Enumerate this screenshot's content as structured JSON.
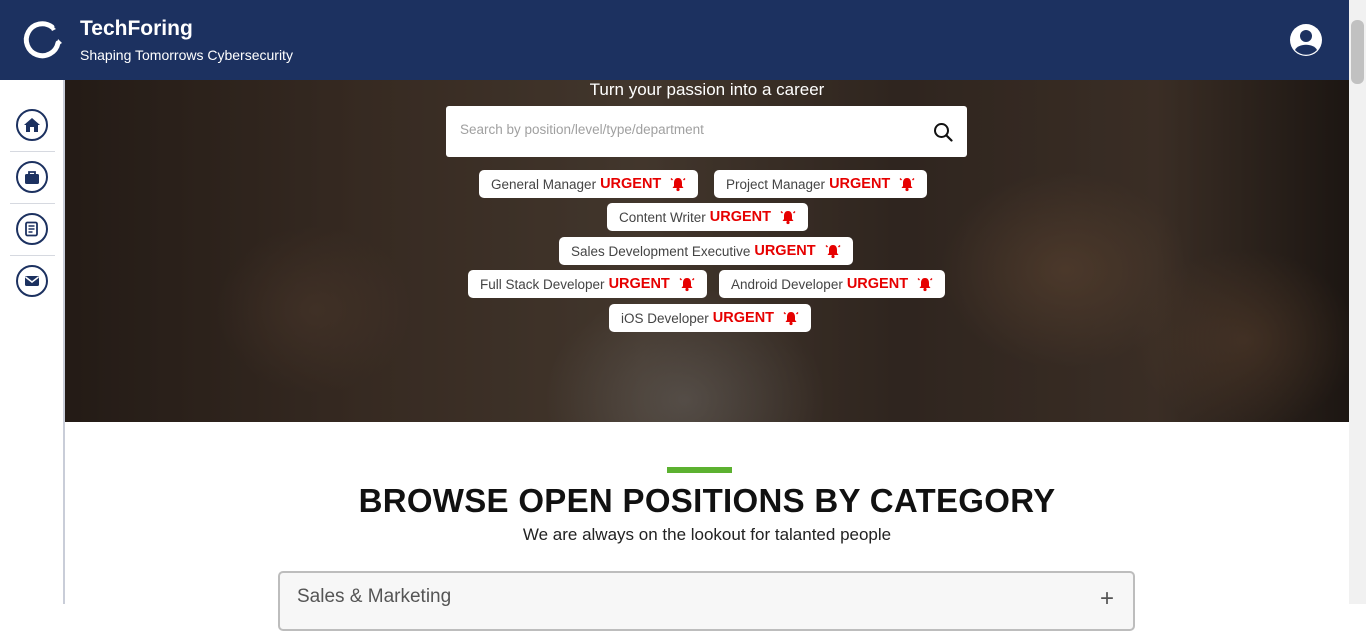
{
  "header": {
    "brand_title": "TechForing",
    "brand_subtitle": "Shaping Tomorrows Cybersecurity",
    "bg_color": "#1c3160",
    "logo_icon": "dragon-ring-logo-icon",
    "user_icon": "user-circle-icon"
  },
  "sidebar": {
    "items": [
      {
        "icon": "home-icon"
      },
      {
        "icon": "briefcase-icon"
      },
      {
        "icon": "document-list-icon"
      },
      {
        "icon": "envelope-icon"
      }
    ]
  },
  "hero": {
    "tagline": "Turn your passion into a career",
    "search_placeholder": "Search by position/level/type/department",
    "search_value": "",
    "urgent_label": "URGENT",
    "urgent_color": "#e60000",
    "jobs": [
      "General Manager",
      "Project Manager",
      "Content Writer",
      "Sales Development Executive",
      "Full Stack Developer",
      "Android Developer",
      "iOS Developer"
    ]
  },
  "positions": {
    "accent_color": "#5cb130",
    "title": "BROWSE OPEN POSITIONS BY CATEGORY",
    "subtitle": "We are always on the lookout for talanted people",
    "categories": [
      {
        "label": "Sales & Marketing",
        "toggle": "+"
      }
    ]
  }
}
